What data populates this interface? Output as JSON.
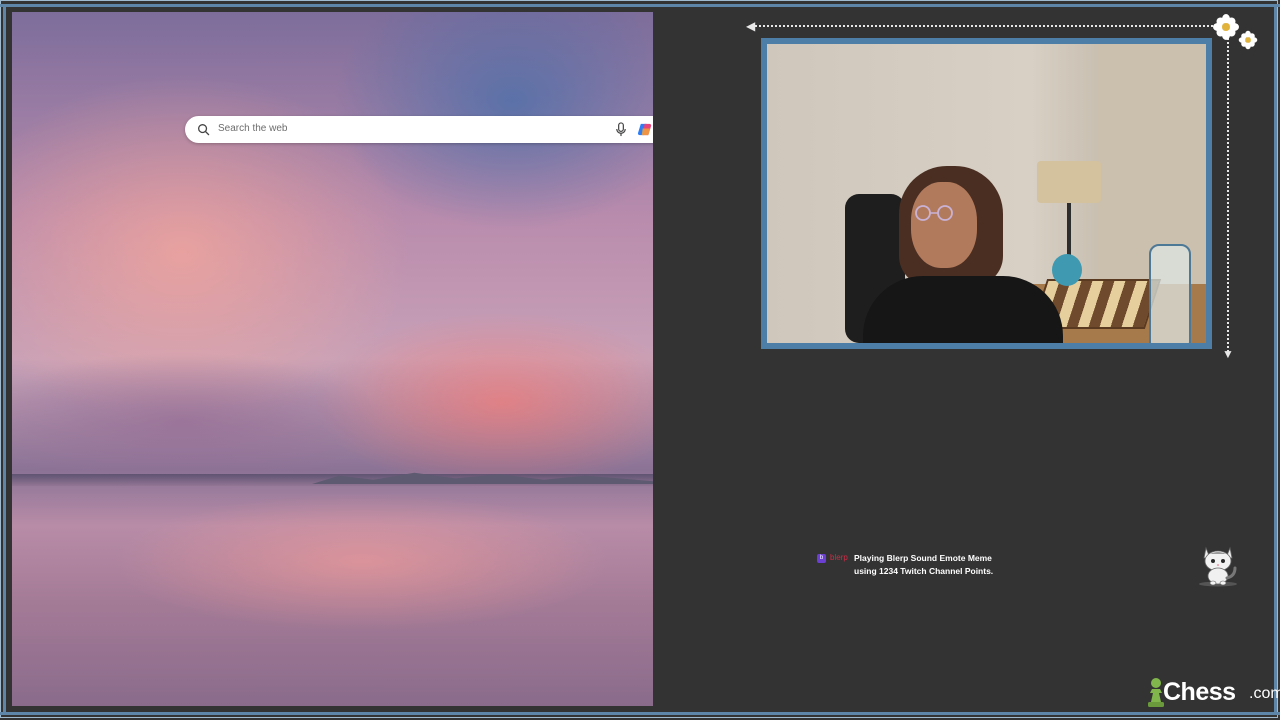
{
  "browser": {
    "search": {
      "placeholder": "Search the web",
      "icons": [
        "search-icon",
        "microphone-icon",
        "copilot-icon"
      ]
    },
    "background": "sunset sky reflection"
  },
  "overlay": {
    "decorations": [
      "dotted-arrow-left",
      "dotted-arrow-down",
      "daisy-flower",
      "daisy-flower"
    ],
    "webcam_border_color": "#4d7ea8"
  },
  "alert": {
    "badge_icon": "blerp-icon",
    "username": "blerp",
    "line1": "Playing Blerp Sound Emote Meme",
    "line2": "using 1234 Twitch Channel Points."
  },
  "branding": {
    "mascot_icon": "cat-mascot-icon",
    "logo_pawn_icon": "pawn-icon",
    "logo_text": "Chess",
    "logo_suffix": ".com",
    "logo_color": "#81b64c"
  },
  "colors": {
    "background": "#333333",
    "frame": "#5d86a8",
    "alert_user": "#d02b45"
  }
}
